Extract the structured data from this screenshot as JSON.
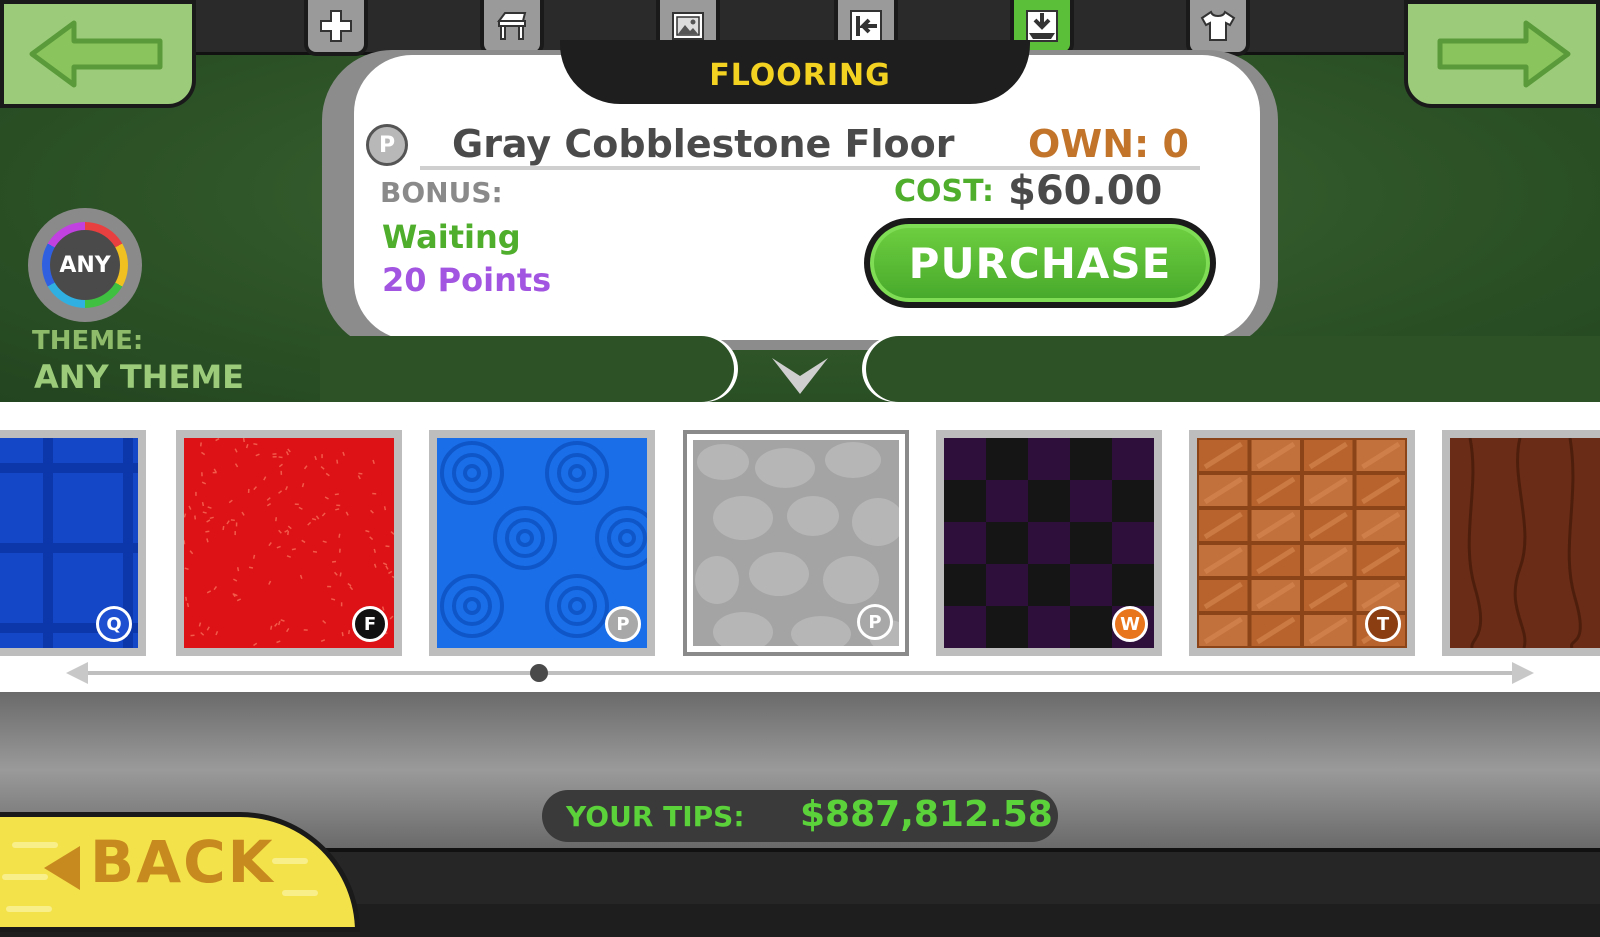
{
  "header": {
    "category_title": "FLOORING",
    "prev_arrow_icon": "left-arrow-icon",
    "next_arrow_icon": "right-arrow-icon",
    "tabs": [
      {
        "name": "add-icon"
      },
      {
        "name": "table-icon"
      },
      {
        "name": "poster-icon"
      },
      {
        "name": "wall-icon"
      },
      {
        "name": "flooring-icon",
        "active": true
      },
      {
        "name": "shirt-icon"
      }
    ]
  },
  "item": {
    "badge_letter": "P",
    "name": "Gray Cobblestone Floor",
    "own_label": "OWN: 0",
    "bonus_label": "BONUS:",
    "bonus_status": "Waiting",
    "bonus_points": "20 Points",
    "cost_label": "COST:",
    "cost_value": "$60.00",
    "purchase_label": "PURCHASE"
  },
  "theme": {
    "ring_label": "ANY",
    "label": "THEME:",
    "value": "ANY THEME"
  },
  "tiles": [
    {
      "name": "blue-plaid-floor",
      "badge": "Q",
      "badge_color": "#1d4fd0"
    },
    {
      "name": "red-speckle-floor",
      "badge": "F",
      "badge_color": "#111111"
    },
    {
      "name": "blue-circles-floor",
      "badge": "P",
      "badge_color": "#a8a8a8"
    },
    {
      "name": "gray-cobblestone-floor",
      "badge": "P",
      "badge_color": "#a8a8a8",
      "selected": true
    },
    {
      "name": "purple-checker-floor",
      "badge": "W",
      "badge_color": "#e8741c"
    },
    {
      "name": "wood-parquet-floor",
      "badge": "T",
      "badge_color": "#8a3e12"
    },
    {
      "name": "dark-wood-floor"
    }
  ],
  "footer": {
    "tips_label": "YOUR TIPS:",
    "tips_value": "$887,812.58",
    "back_label": "BACK"
  },
  "colors": {
    "accent_green": "#5bd13a",
    "title_yellow": "#f4d222",
    "own_orange": "#c1742a",
    "points_purple": "#a255e0"
  }
}
